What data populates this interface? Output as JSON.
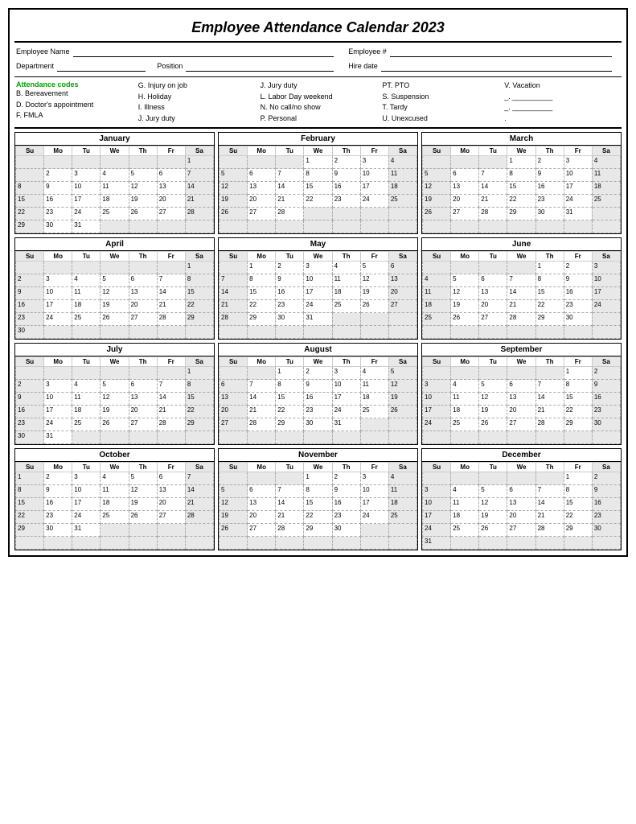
{
  "title": "Employee Attendance Calendar 2023",
  "header": {
    "employee_name_label": "Employee Name",
    "department_label": "Department",
    "position_label": "Position",
    "employee_num_label": "Employee #",
    "hire_date_label": "Hire date"
  },
  "legend": {
    "title": "Attendance codes",
    "col1": [
      "B. Bereavement",
      "D. Doctor's appointment",
      "F.  FMLA"
    ],
    "col2": [
      "G. Injury on job",
      "H. Holiday",
      "I.  Illness",
      "J. Jury duty"
    ],
    "col3": [
      "J. Jury duty",
      "L. Labor Day weekend",
      "N. No call/no show",
      "P. Personal"
    ],
    "col4": [
      "PT. PTO",
      "S. Suspension",
      "T. Tardy",
      "U. Unexcused"
    ],
    "col5": [
      "V. Vacation",
      "_.  __________",
      "_.  __________",
      "."
    ]
  },
  "months": [
    {
      "name": "January",
      "days": [
        1,
        2,
        3,
        4,
        5,
        6,
        7,
        8,
        9,
        10,
        11,
        12,
        13,
        14,
        15,
        16,
        17,
        18,
        19,
        20,
        21,
        22,
        23,
        24,
        25,
        26,
        27,
        28,
        29,
        30,
        31
      ],
      "start_day": 0,
      "weeks": [
        [
          "",
          "",
          "",
          "",
          "",
          "",
          "1"
        ],
        [
          "",
          "2",
          "3",
          "4",
          "5",
          "6",
          "7"
        ],
        [
          "8",
          "9",
          "10",
          "11",
          "12",
          "13",
          "14"
        ],
        [
          "15",
          "16",
          "17",
          "18",
          "19",
          "20",
          "21"
        ],
        [
          "22",
          "23",
          "24",
          "25",
          "26",
          "27",
          "28"
        ],
        [
          "29",
          "30",
          "31",
          "",
          "",
          "",
          ""
        ]
      ]
    },
    {
      "name": "February",
      "weeks": [
        [
          "",
          "",
          "",
          "1",
          "2",
          "3",
          "4"
        ],
        [
          "5",
          "6",
          "7",
          "8",
          "9",
          "10",
          "11"
        ],
        [
          "12",
          "13",
          "14",
          "15",
          "16",
          "17",
          "18"
        ],
        [
          "19",
          "20",
          "21",
          "22",
          "23",
          "24",
          "25"
        ],
        [
          "26",
          "27",
          "28",
          "",
          "",
          "",
          ""
        ],
        [
          "",
          "",
          "",
          "",
          "",
          "",
          ""
        ]
      ]
    },
    {
      "name": "March",
      "weeks": [
        [
          "",
          "",
          "",
          "1",
          "2",
          "3",
          "4"
        ],
        [
          "5",
          "6",
          "7",
          "8",
          "9",
          "10",
          "11"
        ],
        [
          "12",
          "13",
          "14",
          "15",
          "16",
          "17",
          "18"
        ],
        [
          "19",
          "20",
          "21",
          "22",
          "23",
          "24",
          "25"
        ],
        [
          "26",
          "27",
          "28",
          "29",
          "30",
          "31",
          ""
        ],
        [
          "",
          "",
          "",
          "",
          "",
          "",
          ""
        ]
      ]
    },
    {
      "name": "April",
      "weeks": [
        [
          "",
          "",
          "",
          "",
          "",
          "",
          "1"
        ],
        [
          "2",
          "3",
          "4",
          "5",
          "6",
          "7",
          "8"
        ],
        [
          "9",
          "10",
          "11",
          "12",
          "13",
          "14",
          "15"
        ],
        [
          "16",
          "17",
          "18",
          "19",
          "20",
          "21",
          "22"
        ],
        [
          "23",
          "24",
          "25",
          "26",
          "27",
          "28",
          "29"
        ],
        [
          "30",
          "",
          "",
          "",
          "",
          "",
          ""
        ]
      ]
    },
    {
      "name": "May",
      "weeks": [
        [
          "",
          "1",
          "2",
          "3",
          "4",
          "5",
          "6"
        ],
        [
          "7",
          "8",
          "9",
          "10",
          "11",
          "12",
          "13"
        ],
        [
          "14",
          "15",
          "16",
          "17",
          "18",
          "19",
          "20"
        ],
        [
          "21",
          "22",
          "23",
          "24",
          "25",
          "26",
          "27"
        ],
        [
          "28",
          "29",
          "30",
          "31",
          "",
          "",
          ""
        ],
        [
          "",
          "",
          "",
          "",
          "",
          "",
          ""
        ]
      ]
    },
    {
      "name": "June",
      "weeks": [
        [
          "",
          "",
          "",
          "",
          "1",
          "2",
          "3"
        ],
        [
          "4",
          "5",
          "6",
          "7",
          "8",
          "9",
          "10"
        ],
        [
          "11",
          "12",
          "13",
          "14",
          "15",
          "16",
          "17"
        ],
        [
          "18",
          "19",
          "20",
          "21",
          "22",
          "23",
          "24"
        ],
        [
          "25",
          "26",
          "27",
          "28",
          "29",
          "30",
          ""
        ],
        [
          "",
          "",
          "",
          "",
          "",
          "",
          ""
        ]
      ]
    },
    {
      "name": "July",
      "weeks": [
        [
          "",
          "",
          "",
          "",
          "",
          "",
          "1"
        ],
        [
          "2",
          "3",
          "4",
          "5",
          "6",
          "7",
          "8"
        ],
        [
          "9",
          "10",
          "11",
          "12",
          "13",
          "14",
          "15"
        ],
        [
          "16",
          "17",
          "18",
          "19",
          "20",
          "21",
          "22"
        ],
        [
          "23",
          "24",
          "25",
          "26",
          "27",
          "28",
          "29"
        ],
        [
          "30",
          "31",
          "",
          "",
          "",
          "",
          ""
        ]
      ]
    },
    {
      "name": "August",
      "weeks": [
        [
          "",
          "",
          "1",
          "2",
          "3",
          "4",
          "5"
        ],
        [
          "6",
          "7",
          "8",
          "9",
          "10",
          "11",
          "12"
        ],
        [
          "13",
          "14",
          "15",
          "16",
          "17",
          "18",
          "19"
        ],
        [
          "20",
          "21",
          "22",
          "23",
          "24",
          "25",
          "26"
        ],
        [
          "27",
          "28",
          "29",
          "30",
          "31",
          "",
          ""
        ],
        [
          "",
          "",
          "",
          "",
          "",
          "",
          ""
        ]
      ]
    },
    {
      "name": "September",
      "weeks": [
        [
          "",
          "",
          "",
          "",
          "",
          "1",
          "2"
        ],
        [
          "3",
          "4",
          "5",
          "6",
          "7",
          "8",
          "9"
        ],
        [
          "10",
          "11",
          "12",
          "13",
          "14",
          "15",
          "16"
        ],
        [
          "17",
          "18",
          "19",
          "20",
          "21",
          "22",
          "23"
        ],
        [
          "24",
          "25",
          "26",
          "27",
          "28",
          "29",
          "30"
        ],
        [
          "",
          "",
          "",
          "",
          "",
          "",
          ""
        ]
      ]
    },
    {
      "name": "October",
      "weeks": [
        [
          "1",
          "2",
          "3",
          "4",
          "5",
          "6",
          "7"
        ],
        [
          "8",
          "9",
          "10",
          "11",
          "12",
          "13",
          "14"
        ],
        [
          "15",
          "16",
          "17",
          "18",
          "19",
          "20",
          "21"
        ],
        [
          "22",
          "23",
          "24",
          "25",
          "26",
          "27",
          "28"
        ],
        [
          "29",
          "30",
          "31",
          "",
          "",
          "",
          ""
        ],
        [
          "",
          "",
          "",
          "",
          "",
          "",
          ""
        ]
      ]
    },
    {
      "name": "November",
      "weeks": [
        [
          "",
          "",
          "",
          "1",
          "2",
          "3",
          "4"
        ],
        [
          "5",
          "6",
          "7",
          "8",
          "9",
          "10",
          "11"
        ],
        [
          "12",
          "13",
          "14",
          "15",
          "16",
          "17",
          "18"
        ],
        [
          "19",
          "20",
          "21",
          "22",
          "23",
          "24",
          "25"
        ],
        [
          "26",
          "27",
          "28",
          "29",
          "30",
          "",
          ""
        ],
        [
          "",
          "",
          "",
          "",
          "",
          "",
          ""
        ]
      ]
    },
    {
      "name": "December",
      "weeks": [
        [
          "",
          "",
          "",
          "",
          "",
          "1",
          "2"
        ],
        [
          "3",
          "4",
          "5",
          "6",
          "7",
          "8",
          "9"
        ],
        [
          "10",
          "11",
          "12",
          "13",
          "14",
          "15",
          "16"
        ],
        [
          "17",
          "18",
          "19",
          "20",
          "21",
          "22",
          "23"
        ],
        [
          "24",
          "25",
          "26",
          "27",
          "28",
          "29",
          "30"
        ],
        [
          "31",
          "",
          "",
          "",
          "",
          "",
          ""
        ]
      ]
    }
  ],
  "day_headers": [
    "Su",
    "Mo",
    "Tu",
    "We",
    "Th",
    "Fr",
    "Sa"
  ]
}
